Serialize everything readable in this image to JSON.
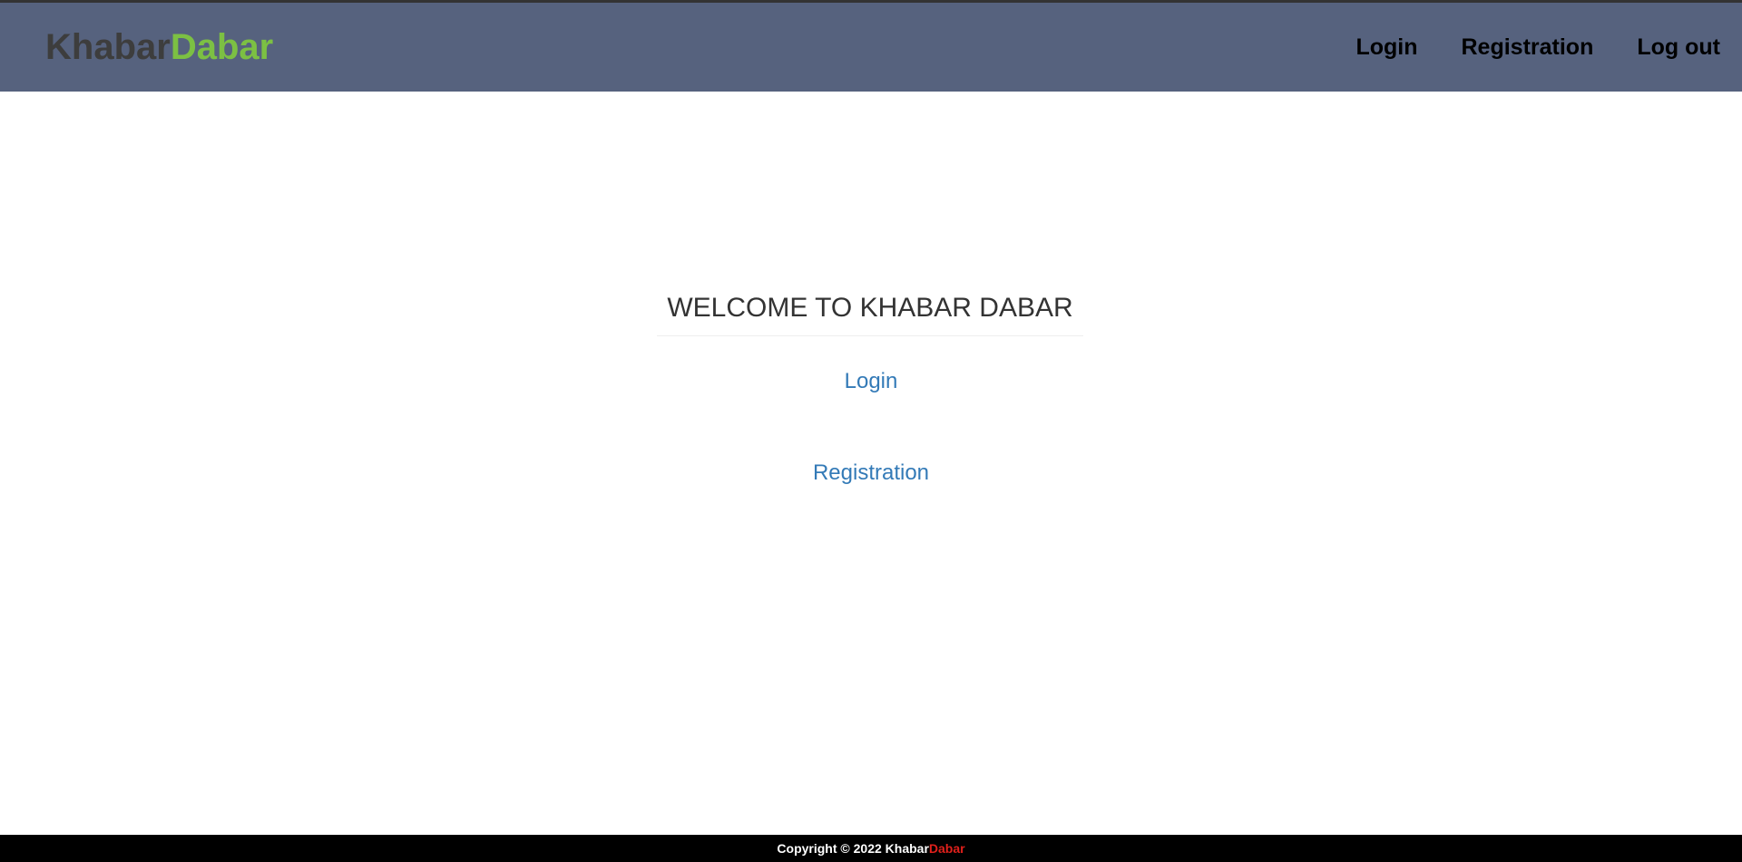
{
  "header": {
    "brand_part1": "Khabar",
    "brand_part2": "Dabar",
    "nav": {
      "login": "Login",
      "registration": "Registration",
      "logout": "Log out"
    }
  },
  "main": {
    "welcome": "WELCOME TO KHABAR DABAR",
    "login_link": "Login",
    "registration_link": "Registration"
  },
  "footer": {
    "copyright": "Copyright © 2022 ",
    "brand_part1": "Khabar",
    "brand_part2": "Dabar"
  },
  "colors": {
    "header_bg": "#56627e",
    "brand_dark": "#3d3d3d",
    "brand_green": "#7cc043",
    "link_blue": "#337ab7",
    "footer_bg": "#000000",
    "footer_brand_red": "#e0201b"
  }
}
